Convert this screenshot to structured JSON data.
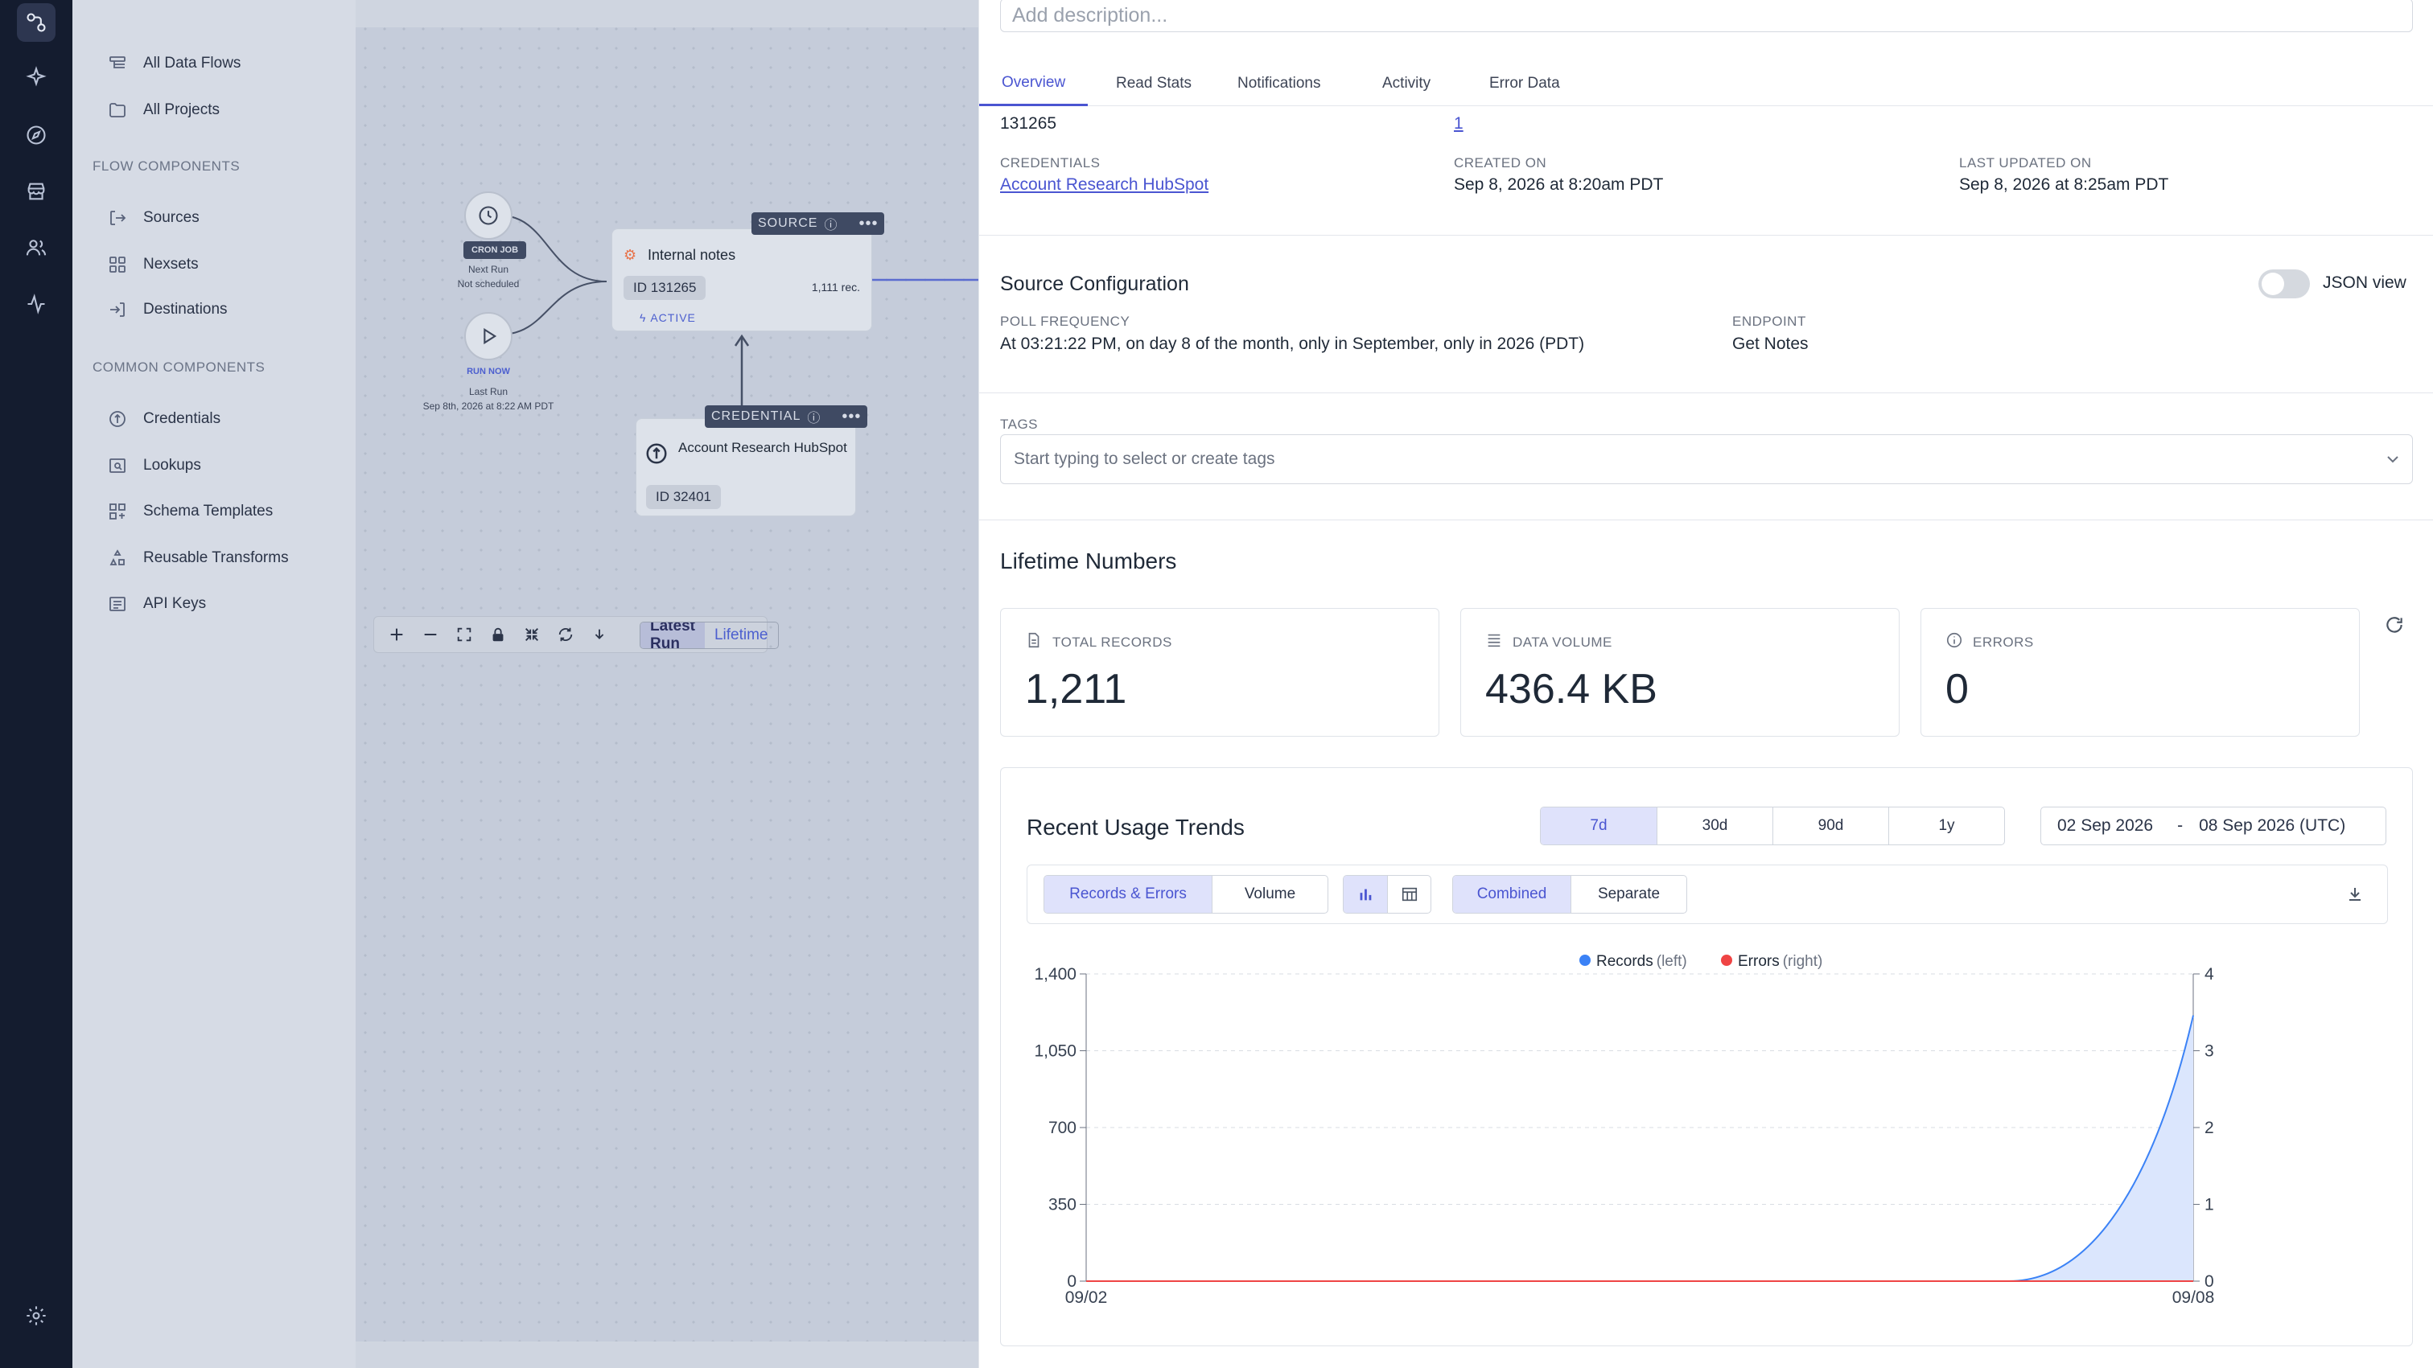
{
  "rail": {
    "icons": [
      "data-flows-icon",
      "sparkle-icon",
      "compass-icon",
      "store-icon",
      "users-icon",
      "activity-icon",
      "gear-icon"
    ]
  },
  "nav": {
    "top_items": [
      {
        "label": "All Data Flows",
        "icon": "data-flows-icon"
      },
      {
        "label": "All Projects",
        "icon": "folder-icon"
      }
    ],
    "flow_section": "FLOW COMPONENTS",
    "flow_items": [
      {
        "label": "Sources",
        "icon": "source-icon"
      },
      {
        "label": "Nexsets",
        "icon": "grid-icon"
      },
      {
        "label": "Destinations",
        "icon": "destination-icon"
      }
    ],
    "common_section": "COMMON COMPONENTS",
    "common_items": [
      {
        "label": "Credentials",
        "icon": "credential-icon"
      },
      {
        "label": "Lookups",
        "icon": "lookup-icon"
      },
      {
        "label": "Schema Templates",
        "icon": "schema-icon"
      },
      {
        "label": "Reusable Transforms",
        "icon": "transform-icon"
      },
      {
        "label": "API Keys",
        "icon": "api-key-icon"
      }
    ]
  },
  "canvas": {
    "cron_tag": "CRON JOB",
    "cron_next": "Next Run",
    "cron_status": "Not scheduled",
    "run_now_tag": "RUN NOW",
    "last_run_label": "Last Run",
    "last_run_value": "Sep 8th, 2026 at 8:22 AM PDT",
    "source_tag": "SOURCE",
    "source_name": "Internal notes",
    "source_id": "ID 131265",
    "source_records": "1,111 rec.",
    "source_status": "ACTIVE",
    "credential_tag": "CREDENTIAL",
    "credential_name": "Account Research HubSpot",
    "credential_id": "ID 32401",
    "toolbar": {
      "latest_run": "Latest Run",
      "lifetime": "Lifetime"
    }
  },
  "panel": {
    "description_placeholder": "Add description...",
    "tabs": [
      "Overview",
      "Read Stats",
      "Notifications",
      "Activity",
      "Error Data"
    ],
    "active_tab": "Overview",
    "source_id_value": "131265",
    "nexsets_value": "1",
    "credentials_label": "CREDENTIALS",
    "credentials_value": "Account Research HubSpot",
    "created_label": "CREATED ON",
    "created_value": "Sep 8, 2026 at 8:20am PDT",
    "updated_label": "LAST UPDATED ON",
    "updated_value": "Sep 8, 2026 at 8:25am PDT",
    "config_title": "Source Configuration",
    "json_view_label": "JSON view",
    "poll_label": "POLL FREQUENCY",
    "poll_value": "At 03:21:22 PM, on day 8 of the month, only in September, only in 2026 (PDT)",
    "endpoint_label": "ENDPOINT",
    "endpoint_value": "Get Notes",
    "tags_label": "TAGS",
    "tags_placeholder": "Start typing to select or create tags",
    "lifetime_title": "Lifetime Numbers",
    "stats": [
      {
        "label": "TOTAL RECORDS",
        "value": "1,211",
        "icon": "document-icon"
      },
      {
        "label": "DATA VOLUME",
        "value": "436.4 KB",
        "icon": "list-icon"
      },
      {
        "label": "ERRORS",
        "value": "0",
        "icon": "info-icon"
      }
    ],
    "trends_title": "Recent Usage Trends",
    "ranges": [
      "7d",
      "30d",
      "90d",
      "1y"
    ],
    "active_range": "7d",
    "date_from": "02 Sep 2026",
    "date_sep": "-",
    "date_to": "08 Sep 2026 (UTC)",
    "metric_tabs": [
      "Records & Errors",
      "Volume"
    ],
    "mode_tabs": [
      "Combined",
      "Separate"
    ]
  },
  "colors": {
    "accent": "#4a55d1",
    "records": "#3b82f6",
    "errors": "#ef4444",
    "rail_bg": "#141c2f"
  },
  "chart_data": {
    "type": "area",
    "x": [
      "09/02",
      "09/03",
      "09/04",
      "09/05",
      "09/06",
      "09/07",
      "09/08"
    ],
    "x_tick_labels": [
      "09/02",
      "09/08"
    ],
    "series": [
      {
        "name": "Records",
        "axis_label": "(left)",
        "axis": "left",
        "values": [
          0,
          0,
          0,
          0,
          0,
          0,
          1211
        ]
      },
      {
        "name": "Errors",
        "axis_label": "(right)",
        "axis": "right",
        "values": [
          0,
          0,
          0,
          0,
          0,
          0,
          0
        ]
      }
    ],
    "y_left": {
      "ticks": [
        0,
        350,
        700,
        1050,
        1400
      ],
      "tick_labels": [
        "0",
        "350",
        "700",
        "1,050",
        "1,400"
      ],
      "lim": [
        0,
        1400
      ]
    },
    "y_right": {
      "ticks": [
        0,
        1,
        2,
        3,
        4
      ],
      "lim": [
        0,
        4
      ]
    },
    "grid": true,
    "legend": "top-center"
  }
}
